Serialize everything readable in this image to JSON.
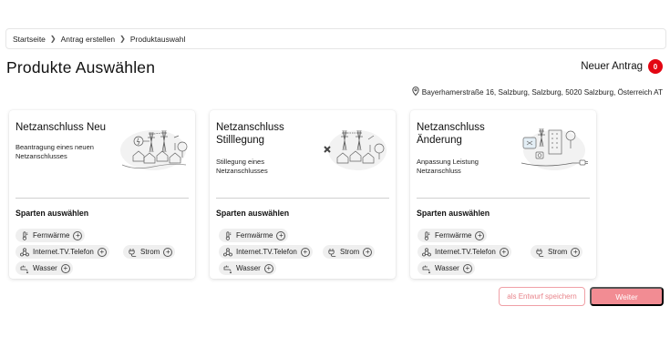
{
  "breadcrumb": {
    "items": [
      "Startseite",
      "Antrag erstellen",
      "Produktauswahl"
    ]
  },
  "header": {
    "title": "Produkte Auswählen",
    "cart_label": "Neuer Antrag",
    "cart_count": "0"
  },
  "address": {
    "icon": "location-pin-icon",
    "text": "Bayerhamerstraße 16, Salzburg, Salzburg, 5020 Salzburg, Österreich AT"
  },
  "sparten_label": "Sparten auswählen",
  "sparten": {
    "fernwaerme": {
      "label": "Fernwärme",
      "icon": "thermometer-icon"
    },
    "internet": {
      "label": "Internet.TV.Telefon",
      "icon": "network-icon"
    },
    "strom": {
      "label": "Strom",
      "icon": "plug-icon"
    },
    "wasser": {
      "label": "Wasser",
      "icon": "water-tap-icon"
    }
  },
  "cards": [
    {
      "title_line1": "Netzanschluss Neu",
      "title_line2": "",
      "desc_line1": "Beantragung eines neuen",
      "desc_line2": "Netzanschlusses"
    },
    {
      "title_line1": "Netzanschluss",
      "title_line2": "Stilllegung",
      "desc_line1": "Stillegung eines",
      "desc_line2": "Netzanschlusses"
    },
    {
      "title_line1": "Netzanschluss",
      "title_line2": "Änderung",
      "desc_line1": "Anpassung Leistung",
      "desc_line2": "Netzanschluss"
    }
  ],
  "actions": {
    "draft_label": "als Entwurf speichern",
    "next_label": "Weiter"
  },
  "colors": {
    "accent": "#e30613",
    "button_primary": "#f28c93",
    "button_outline": "#f0a0a6",
    "chip_bg": "#efefef"
  }
}
